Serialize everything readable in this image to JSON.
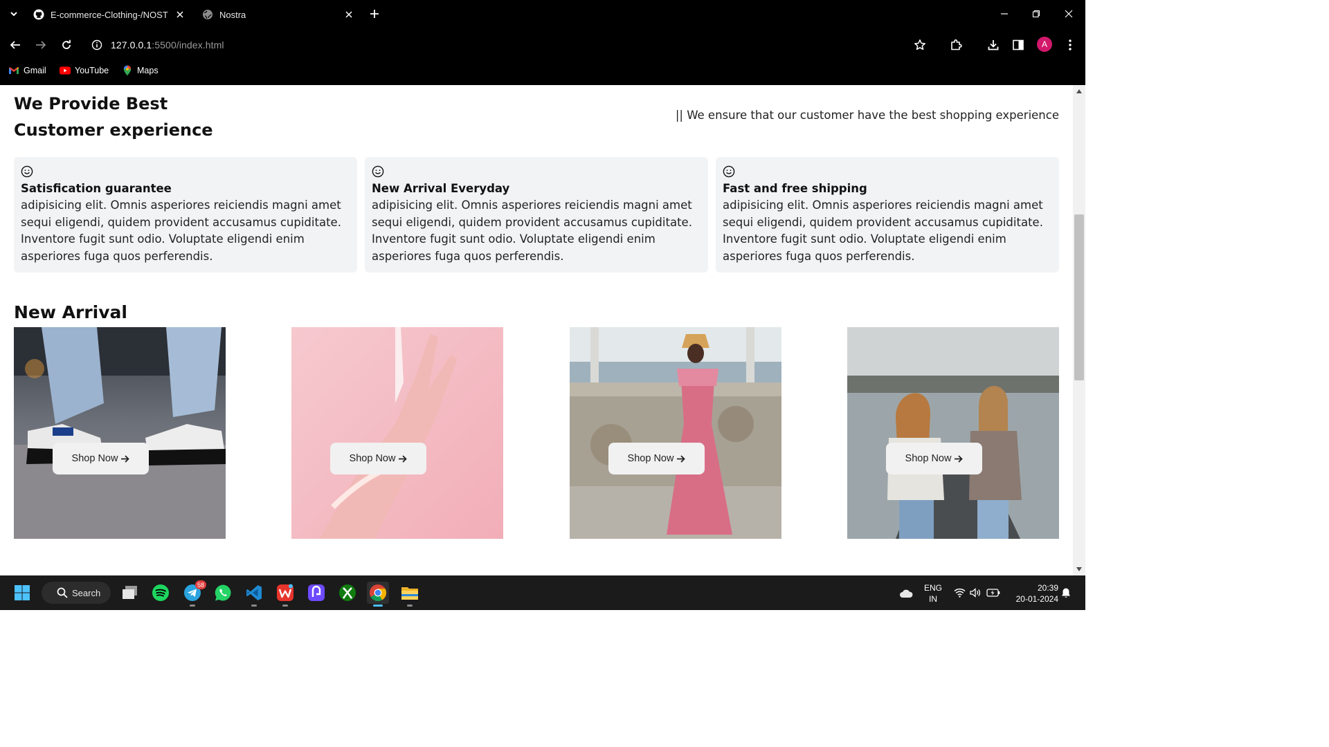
{
  "browser": {
    "tabs": [
      {
        "title": "E-commerce-Clothing-/NOSTR",
        "icon": "github-icon",
        "active": false
      },
      {
        "title": "Nostra",
        "icon": "globe-icon",
        "active": true
      }
    ],
    "url_host": "127.0.0.1",
    "url_path": ":5500/index.html",
    "profile_initial": "A",
    "bookmarks": [
      {
        "label": "Gmail",
        "icon": "gmail-icon"
      },
      {
        "label": "YouTube",
        "icon": "youtube-icon"
      },
      {
        "label": "Maps",
        "icon": "maps-icon"
      }
    ]
  },
  "page": {
    "hero": {
      "title_line1": "We Provide Best",
      "title_line2": "Customer experience",
      "subtitle": "|| We ensure that our customer have the best shopping experience"
    },
    "features": [
      {
        "title": "Satisfication guarantee",
        "icon": "smile-icon",
        "description": "adipisicing elit. Omnis asperiores reiciendis magni amet sequi eligendi, quidem provident accusamus cupiditate. Inventore fugit sunt odio. Voluptate eligendi enim asperiores fuga quos perferendis."
      },
      {
        "title": "New Arrival Everyday",
        "icon": "smile-icon",
        "description": "adipisicing elit. Omnis asperiores reiciendis magni amet sequi eligendi, quidem provident accusamus cupiditate. Inventore fugit sunt odio. Voluptate eligendi enim asperiores fuga quos perferendis."
      },
      {
        "title": "Fast and free shipping",
        "icon": "smile-icon",
        "description": "adipisicing elit. Omnis asperiores reiciendis magni amet sequi eligendi, quidem provident accusamus cupiditate. Inventore fugit sunt odio. Voluptate eligendi enim asperiores fuga quos perferendis."
      }
    ],
    "new_arrival": {
      "title": "New Arrival",
      "products": [
        {
          "image": "sneakers-photo",
          "button": "Shop Now"
        },
        {
          "image": "hand-pink-photo",
          "button": "Shop Now"
        },
        {
          "image": "pink-dress-photo",
          "button": "Shop Now"
        },
        {
          "image": "two-women-pier-photo",
          "button": "Shop Now"
        }
      ]
    }
  },
  "taskbar": {
    "search_label": "Search",
    "telegram_badge": "58",
    "lang_line1": "ENG",
    "lang_line2": "IN",
    "time": "20:39",
    "date": "20-01-2024"
  }
}
